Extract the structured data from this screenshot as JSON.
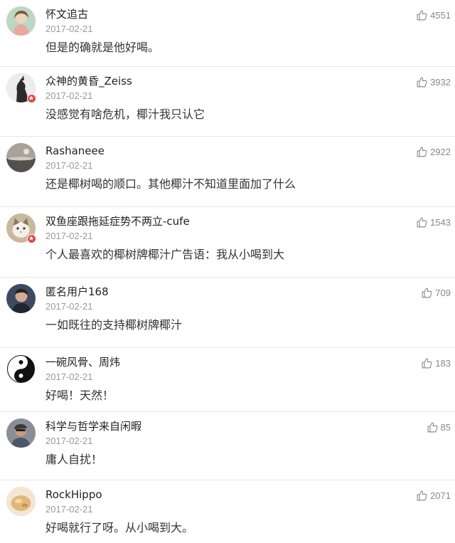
{
  "comments": [
    {
      "username": "怀文追古",
      "date": "2017-02-21",
      "text": "但是的确就是他好喝。",
      "likes": "4551",
      "verified": false,
      "avatar": "illustrated-portrait"
    },
    {
      "username": "众神的黄昏_Zeiss",
      "date": "2017-02-21",
      "text": "没感觉有啥危机，椰汁我只认它",
      "likes": "3932",
      "verified": true,
      "avatar": "dark-figure"
    },
    {
      "username": "Rashaneee",
      "date": "2017-02-21",
      "text": "还是椰树喝的顺口。其他椰汁不知道里面加了什么",
      "likes": "2922",
      "verified": false,
      "avatar": "landscape"
    },
    {
      "username": "双鱼座跟拖延症势不两立-cufe",
      "date": "2017-02-21",
      "text": "个人最喜欢的椰树牌椰汁广告语：我从小喝到大",
      "likes": "1543",
      "verified": true,
      "avatar": "cat"
    },
    {
      "username": "匿名用户168",
      "date": "2017-02-21",
      "text": "一如既往的支持椰树牌椰汁",
      "likes": "709",
      "verified": false,
      "avatar": "portrait"
    },
    {
      "username": "一碗风骨、周炜",
      "date": "2017-02-21",
      "text": "好喝！天然！",
      "likes": "183",
      "verified": false,
      "avatar": "yin-yang"
    },
    {
      "username": "科学与哲学来自闲暇",
      "date": "2017-02-21",
      "text": "庸人自扰！",
      "likes": "85",
      "verified": false,
      "avatar": "person-photo"
    },
    {
      "username": "RockHippo",
      "date": "2017-02-21",
      "text": "好喝就行了呀。从小喝到大。",
      "likes": "2071",
      "verified": false,
      "avatar": "food"
    }
  ],
  "colors": {
    "username": "#222222",
    "date": "#999999",
    "text": "#333333",
    "likes": "#888888",
    "divider": "#e6e6e6",
    "verified_badge": "#e8403a"
  },
  "icons": {
    "like": "thumbs-up-icon",
    "verified": "verified-badge-icon"
  }
}
